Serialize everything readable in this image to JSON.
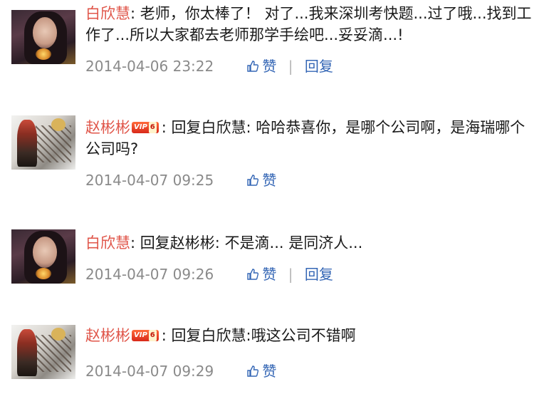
{
  "comments": [
    {
      "author": "白欣慧",
      "vip": false,
      "text_line1": "老师，你太棒了！ 对了...我来深圳考快题...过了哦...找到工",
      "text_line2": "作了...所以大家都去老师那学手绘吧...妥妥滴...!",
      "time": "2014-04-06 23:22",
      "like_label": "赞",
      "separator": "|",
      "reply_label": "回复"
    },
    {
      "author": "赵彬彬",
      "vip": true,
      "vip_label": "VIP",
      "vip_level": "6",
      "text_line1": "回复白欣慧: 哈哈恭喜你，是哪个公司啊，是海瑞哪个",
      "text_line2": "公司吗?",
      "time": "2014-04-07 09:25",
      "like_label": "赞"
    },
    {
      "author": "白欣慧",
      "vip": false,
      "text_line1": "回复赵彬彬: 不是滴... 是同济人...",
      "time": "2014-04-07 09:26",
      "like_label": "赞",
      "separator": "|",
      "reply_label": "回复"
    },
    {
      "author": "赵彬彬",
      "vip": true,
      "vip_label": "VIP",
      "vip_level": "6",
      "text_line1": "回复白欣慧:哦这公司不错啊",
      "time": "2014-04-07 09:29",
      "like_label": "赞"
    }
  ],
  "colors": {
    "author": "#e0564a",
    "link": "#3466b5",
    "meta": "#8a8a8a",
    "text": "#1a1a1a"
  },
  "icons": {
    "like": "thumbs-up-icon"
  }
}
